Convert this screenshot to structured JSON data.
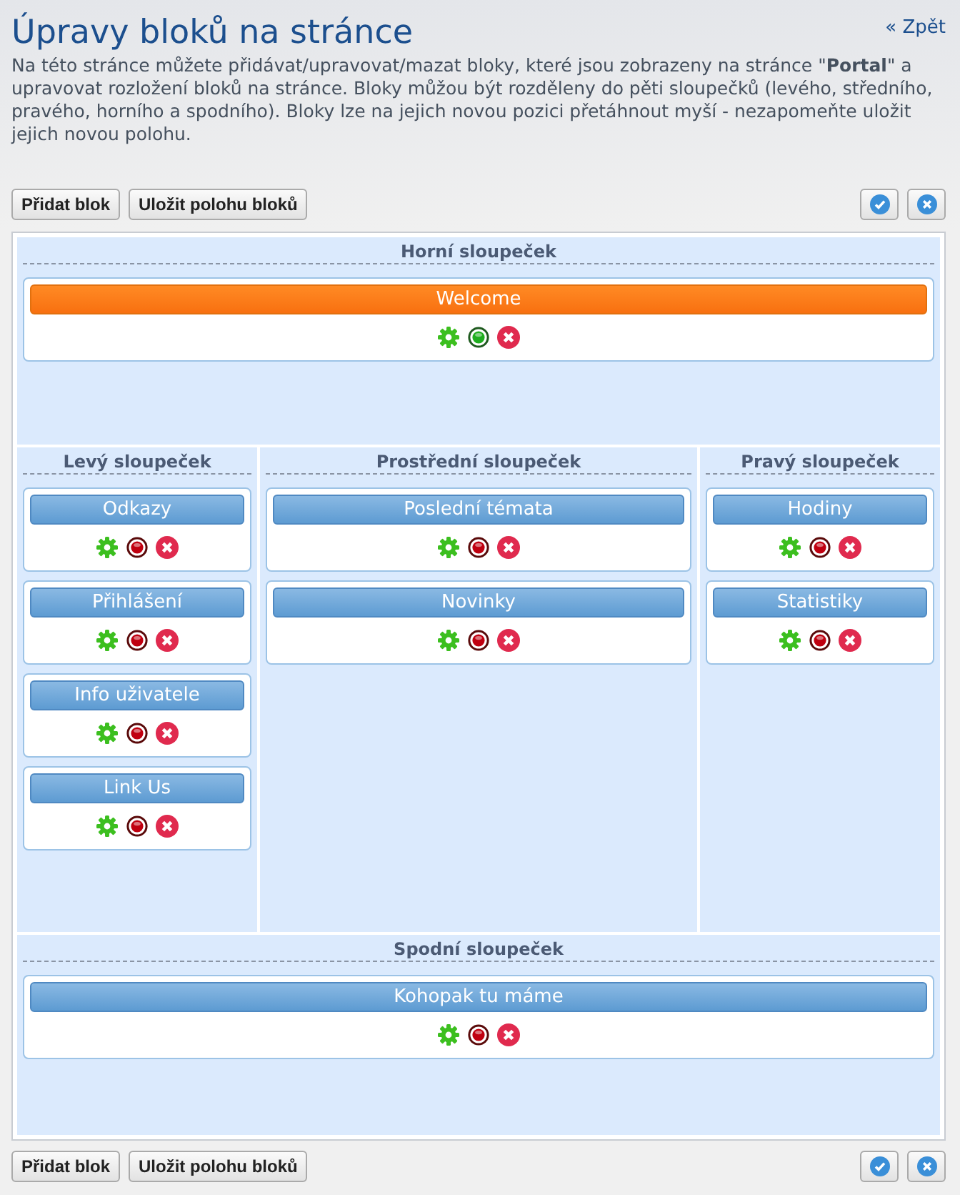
{
  "header": {
    "title": "Úpravy bloků na stránce",
    "back_link": "« Zpět",
    "description": "Na této stránce můžete přidávat/upravovat/mazat bloky, které jsou zobrazeny na stránce \"**Portal**\" a upravovat rozložení bloků na stránce. Bloky můžou být rozděleny do pěti sloupečků (levého, středního, pravého, horního a spodního). Bloky lze na jejich novou pozici přetáhnout myší - nezapomeňte uložit jejich novou polohu."
  },
  "toolbar_top": {
    "buttons": [
      "Přidat blok",
      "Uložit polohu bloků"
    ]
  },
  "columns": {
    "top": {
      "title": "Horní sloupeček",
      "blocks": [
        {
          "title": "Welcome",
          "selected": true,
          "active": true
        }
      ]
    },
    "left": {
      "title": "Levý sloupeček",
      "blocks": [
        {
          "title": "Odkazy",
          "selected": false,
          "active": false
        },
        {
          "title": "Přihlášení",
          "selected": false,
          "active": false
        },
        {
          "title": "Info uživatele",
          "selected": false,
          "active": false
        },
        {
          "title": "Link Us",
          "selected": false,
          "active": false
        }
      ]
    },
    "middle": {
      "title": "Prostřední sloupeček",
      "blocks": [
        {
          "title": "Poslední témata",
          "selected": false,
          "active": false
        },
        {
          "title": "Novinky",
          "selected": false,
          "active": false
        }
      ]
    },
    "right": {
      "title": "Pravý sloupeček",
      "blocks": [
        {
          "title": "Hodiny",
          "selected": false,
          "active": false
        },
        {
          "title": "Statistiky",
          "selected": false,
          "active": false
        }
      ]
    },
    "bottom": {
      "title": "Spodní sloupeček",
      "blocks": [
        {
          "title": "Kohopak tu máme",
          "selected": false,
          "active": false
        }
      ]
    }
  },
  "toolbar_bottom": {
    "buttons": [
      "Přidat blok",
      "Uložit polohu bloků"
    ]
  }
}
